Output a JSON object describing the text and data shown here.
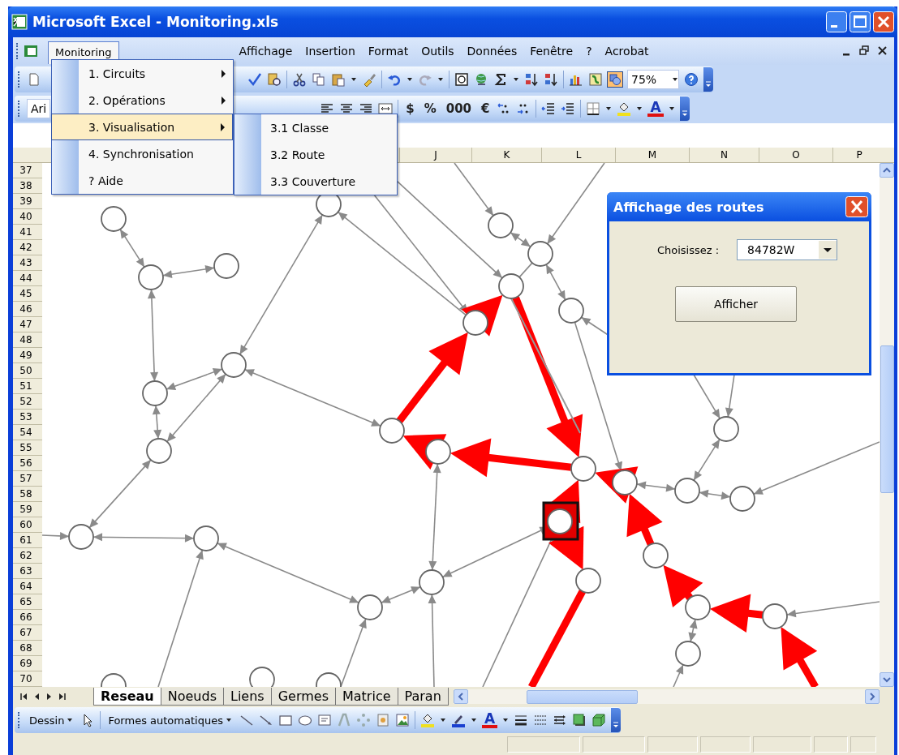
{
  "window": {
    "title": "Microsoft Excel - Monitoring.xls"
  },
  "menu_bar": {
    "items": [
      {
        "label": "Monitoring",
        "selected": true
      },
      {
        "label": "Affichage",
        "selected": false
      },
      {
        "label": "Insertion",
        "selected": false
      },
      {
        "label": "Format",
        "selected": false
      },
      {
        "label": "Outils",
        "selected": false
      },
      {
        "label": "Données",
        "selected": false
      },
      {
        "label": "Fenêtre",
        "selected": false
      },
      {
        "label": "?",
        "selected": false
      },
      {
        "label": "Acrobat",
        "selected": false
      }
    ]
  },
  "monitoring_menu": {
    "items": [
      {
        "label": "1. Circuits",
        "submenu": true,
        "selected": false
      },
      {
        "label": "2. Opérations",
        "submenu": true,
        "selected": false
      },
      {
        "label": "3. Visualisation",
        "submenu": true,
        "selected": true
      },
      {
        "label": "4. Synchronisation",
        "submenu": false,
        "selected": false
      },
      {
        "label": "? Aide",
        "submenu": false,
        "selected": false
      }
    ]
  },
  "visualisation_submenu": {
    "items": [
      {
        "label": "3.1 Classe"
      },
      {
        "label": "3.2 Route"
      },
      {
        "label": "3.3 Couverture"
      }
    ]
  },
  "standard_toolbar": {
    "zoom": "75%"
  },
  "formatting_toolbar": {
    "font": "Ari",
    "buttons": [
      "$",
      "%",
      "000",
      "€"
    ],
    "font_color": "A"
  },
  "sheet": {
    "columns": [
      "J",
      "K",
      "L",
      "M",
      "N",
      "O",
      "P"
    ],
    "rows": [
      "37",
      "38",
      "39",
      "40",
      "41",
      "42",
      "43",
      "44",
      "45",
      "46",
      "47",
      "48",
      "49",
      "50",
      "51",
      "52",
      "53",
      "54",
      "55",
      "56",
      "57",
      "58",
      "59",
      "60",
      "61",
      "62",
      "63",
      "64",
      "65",
      "66",
      "67",
      "68",
      "69",
      "70"
    ]
  },
  "dialog": {
    "title": "Affichage des routes",
    "label": "Choisissez :",
    "value": "84782W",
    "button": "Afficher"
  },
  "sheet_tabs": [
    {
      "label": "Reseau",
      "selected": true
    },
    {
      "label": "Noeuds",
      "selected": false
    },
    {
      "label": "Liens",
      "selected": false
    },
    {
      "label": "Germes",
      "selected": false
    },
    {
      "label": "Matrice",
      "selected": false
    },
    {
      "label": "Paran",
      "selected": false
    }
  ],
  "drawing_toolbar": {
    "menus": [
      "Dessin",
      "Formes automatiques"
    ],
    "font_color": "A"
  }
}
